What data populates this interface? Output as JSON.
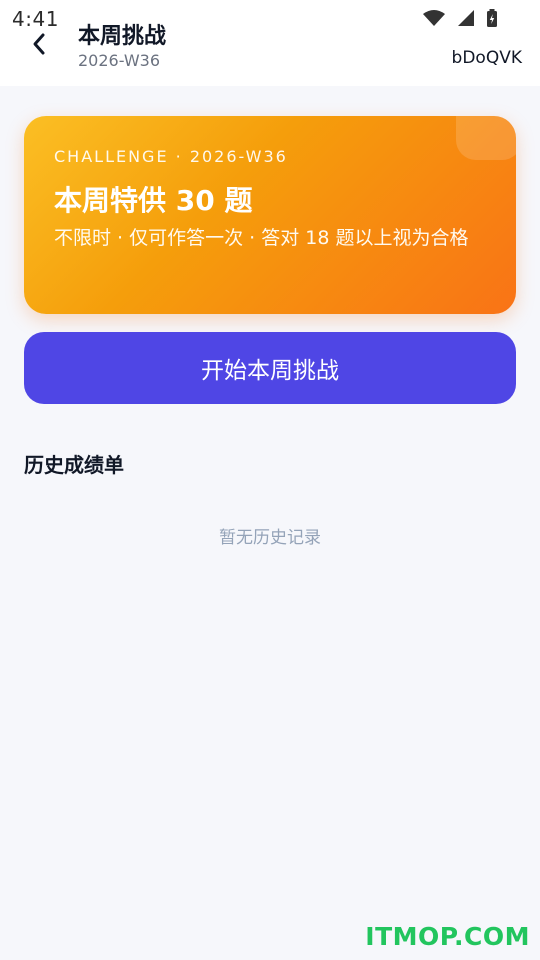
{
  "status_bar": {
    "time": "4:41",
    "icons": [
      "wifi-icon",
      "signal-icon",
      "battery-icon"
    ]
  },
  "header": {
    "back_icon": "back-icon",
    "title": "本周挑战",
    "subtitle": "2026-W36",
    "user_code": "bDoQVK"
  },
  "challenge_card": {
    "label": "CHALLENGE · 2026-W36",
    "title": "本周特供 30 题",
    "description": "不限时 · 仅可作答一次 · 答对 18 题以上视为合格",
    "colors": {
      "gradient_start": "#fbbf24",
      "gradient_end": "#f97316"
    }
  },
  "start_button": {
    "label": "开始本周挑战",
    "color": "#4f46e5"
  },
  "history": {
    "heading": "历史成绩单",
    "empty_text": "暂无历史记录"
  },
  "site_watermark": {
    "text": "ITMOP.COM",
    "color": "#22c55e"
  }
}
